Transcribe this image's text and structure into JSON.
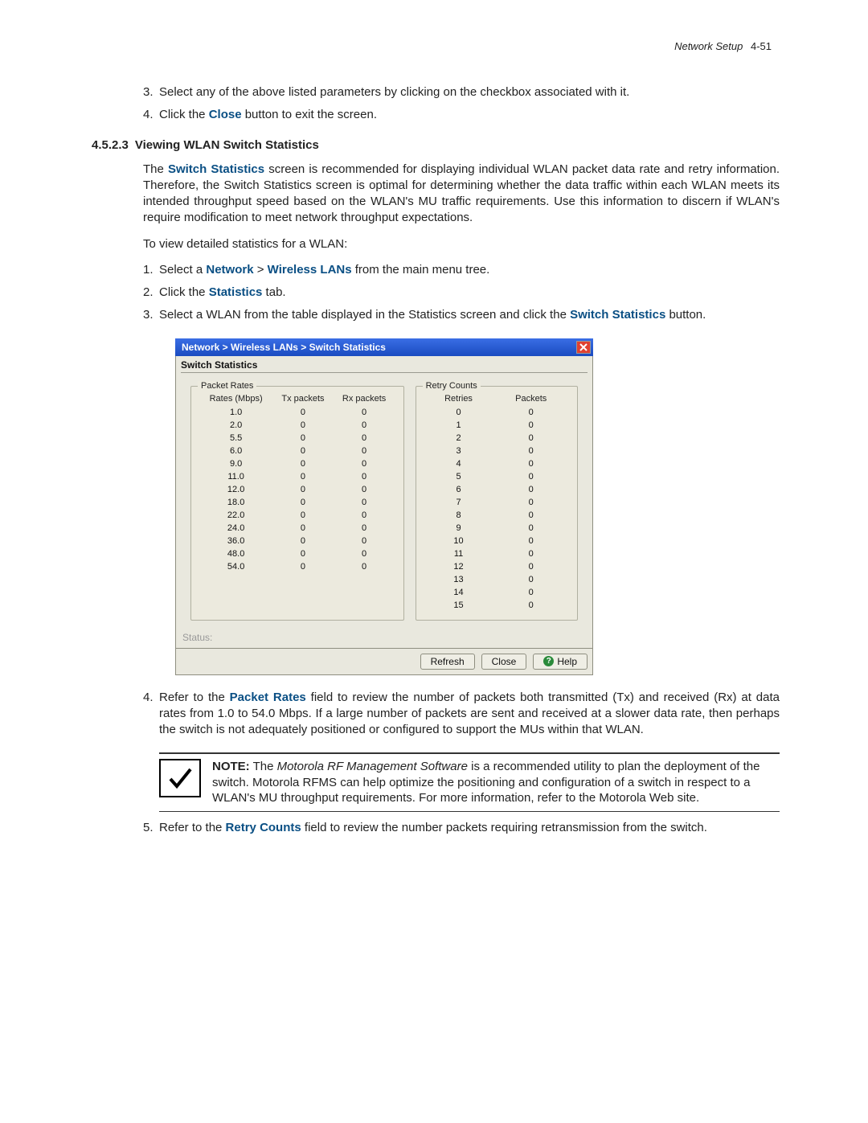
{
  "header": {
    "title": "Network Setup",
    "page": "4-51"
  },
  "list_top": [
    {
      "num": "3.",
      "pre": "Select any of the above listed parameters by clicking on the checkbox associated with it."
    },
    {
      "num": "4.",
      "pre": "Click the ",
      "bold": "Close",
      "post": " button to exit the screen."
    }
  ],
  "section": {
    "number": "4.5.2.3",
    "title": "Viewing WLAN Switch Statistics"
  },
  "para1": {
    "pre": "The ",
    "bold": "Switch Statistics",
    "post": " screen is recommended for displaying individual WLAN packet data rate and retry information. Therefore, the Switch Statistics screen is optimal for determining whether the data traffic within each WLAN meets its intended throughput speed based on the WLAN's MU traffic requirements. Use this information to discern if WLAN's require modification to meet network throughput expectations."
  },
  "para2": "To view detailed statistics for a WLAN:",
  "list_steps": [
    {
      "num": "1.",
      "pre": "Select a ",
      "b1": "Network",
      "sep": " > ",
      "b2": "Wireless LANs",
      "post": " from the main menu tree."
    },
    {
      "num": "2.",
      "pre": "Click the ",
      "b1": "Statistics",
      "post": " tab."
    },
    {
      "num": "3.",
      "pre": "Select a WLAN from the table displayed in the Statistics screen and click the ",
      "b1": "Switch Statistics",
      "post": " button."
    }
  ],
  "dialog": {
    "title": "Network > Wireless LANs > Switch Statistics",
    "tab": "Switch Statistics",
    "packet_rates": {
      "title": "Packet Rates",
      "headers": [
        "Rates (Mbps)",
        "Tx packets",
        "Rx packets"
      ],
      "rows": [
        [
          "1.0",
          "0",
          "0"
        ],
        [
          "2.0",
          "0",
          "0"
        ],
        [
          "5.5",
          "0",
          "0"
        ],
        [
          "6.0",
          "0",
          "0"
        ],
        [
          "9.0",
          "0",
          "0"
        ],
        [
          "11.0",
          "0",
          "0"
        ],
        [
          "12.0",
          "0",
          "0"
        ],
        [
          "18.0",
          "0",
          "0"
        ],
        [
          "22.0",
          "0",
          "0"
        ],
        [
          "24.0",
          "0",
          "0"
        ],
        [
          "36.0",
          "0",
          "0"
        ],
        [
          "48.0",
          "0",
          "0"
        ],
        [
          "54.0",
          "0",
          "0"
        ]
      ]
    },
    "retry_counts": {
      "title": "Retry Counts",
      "headers": [
        "Retries",
        "Packets"
      ],
      "rows": [
        [
          "0",
          "0"
        ],
        [
          "1",
          "0"
        ],
        [
          "2",
          "0"
        ],
        [
          "3",
          "0"
        ],
        [
          "4",
          "0"
        ],
        [
          "5",
          "0"
        ],
        [
          "6",
          "0"
        ],
        [
          "7",
          "0"
        ],
        [
          "8",
          "0"
        ],
        [
          "9",
          "0"
        ],
        [
          "10",
          "0"
        ],
        [
          "11",
          "0"
        ],
        [
          "12",
          "0"
        ],
        [
          "13",
          "0"
        ],
        [
          "14",
          "0"
        ],
        [
          "15",
          "0"
        ]
      ]
    },
    "status": "Status:",
    "buttons": {
      "refresh": "Refresh",
      "close": "Close",
      "help": "Help"
    }
  },
  "list_after": [
    {
      "num": "4.",
      "pre": "Refer to the ",
      "b1": "Packet Rates",
      "post": " field to review the number of packets both transmitted (Tx) and received (Rx) at data rates from 1.0 to 54.0 Mbps. If a large number of packets are sent and received at a slower data rate, then perhaps the switch is not adequately positioned or configured to support the MUs within that WLAN."
    }
  ],
  "note": {
    "label": "NOTE:",
    "pre": " The ",
    "italic": "Motorola RF Management Software",
    "post": " is a recommended utility to plan the deployment of the switch. Motorola RFMS can help optimize the positioning and configuration of a switch in respect to a WLAN's MU throughput requirements. For more information, refer to the Motorola Web site."
  },
  "list_after2": [
    {
      "num": "5.",
      "pre": "Refer to the ",
      "b1": "Retry Counts",
      "post": " field to review the number packets requiring retransmission from the switch."
    }
  ]
}
